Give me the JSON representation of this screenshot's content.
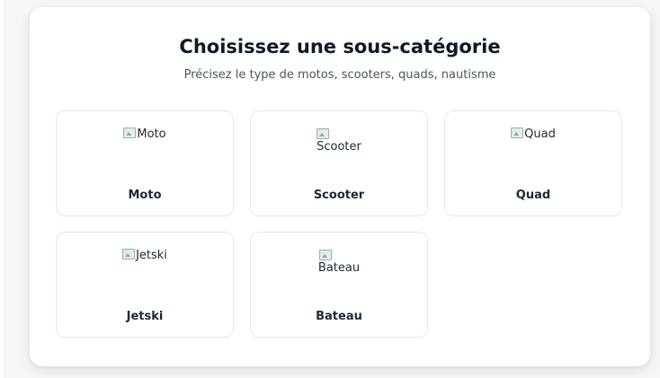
{
  "header": {
    "title": "Choisissez une sous-catégorie",
    "subtitle": "Précisez le type de motos, scooters, quads, nautisme"
  },
  "categories": [
    {
      "label": "Moto",
      "image_alt": "Moto"
    },
    {
      "label": "Scooter",
      "image_alt": "Scooter"
    },
    {
      "label": "Quad",
      "image_alt": "Quad"
    },
    {
      "label": "Jetski",
      "image_alt": "Jetski"
    },
    {
      "label": "Bateau",
      "image_alt": "Bateau"
    }
  ]
}
